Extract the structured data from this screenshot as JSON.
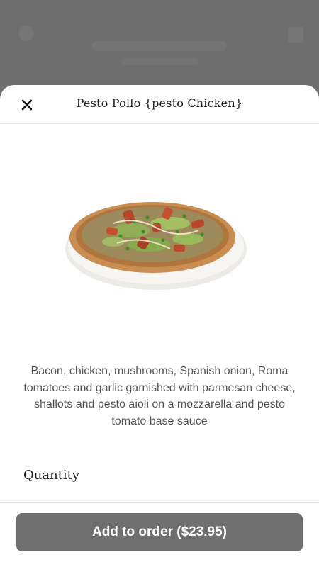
{
  "item": {
    "title": "Pesto Pollo {pesto Chicken}",
    "description": "Bacon, chicken, mushrooms, Spanish onion, Roma tomatoes and garlic garnished with parmesan cheese, shallots and pesto aioli on a mozzarella and pesto tomato base sauce",
    "image_name": "pizza-image"
  },
  "quantity": {
    "label": "Quantity"
  },
  "footer": {
    "add_button_label": "Add to order ($23.95)"
  },
  "icons": {
    "close": "close-icon"
  },
  "colors": {
    "button_bg": "#6f6f6f",
    "overlay": "#6b6b6b",
    "sheet_bg": "#ffffff"
  }
}
